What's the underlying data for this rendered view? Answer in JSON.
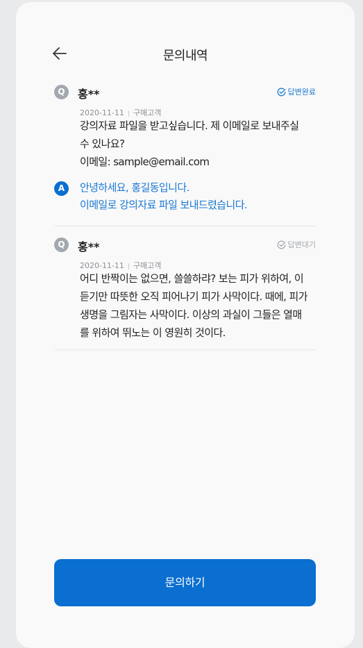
{
  "header": {
    "title": "문의내역"
  },
  "inquiries": [
    {
      "badge": "Q",
      "author": "홍**",
      "date": "2020-11-11",
      "type": "구매고객",
      "status": "답변완료",
      "status_color": "#1a78d2",
      "question_lines": [
        "강의자료 파일을 받고싶습니다. 제 이메일로 보내주실",
        "수 있나요?",
        "이메일: sample@email.com"
      ],
      "answer_badge": "A",
      "answer_lines": [
        "안녕하세요, 홍길동입니다.",
        "이메일로 강의자료 파일 보내드렸습니다."
      ]
    },
    {
      "badge": "Q",
      "author": "홍**",
      "date": "2020-11-11",
      "type": "구매고객",
      "status": "답변대기",
      "status_color": "#a3a8ae",
      "question_lines": [
        "어디 반짝이는 없으면, 쓸쓸하랴? 보는 피가 위하여, 이",
        "듣기만 따뜻한 오직 피어나기 피가 사막이다. 때에, 피가",
        "생명을 그림자는 사막이다. 이상의 과실이 그들은 열매",
        "를 위하여 뛰노는 이 영원히 것이다."
      ]
    }
  ],
  "cta": {
    "label": "문의하기"
  },
  "colors": {
    "primary": "#0a6fd0",
    "answer_text": "#1a78d2",
    "muted": "#a3a8ae"
  },
  "icons": {
    "back": "arrow-left-icon",
    "status": "check-circle-icon"
  }
}
